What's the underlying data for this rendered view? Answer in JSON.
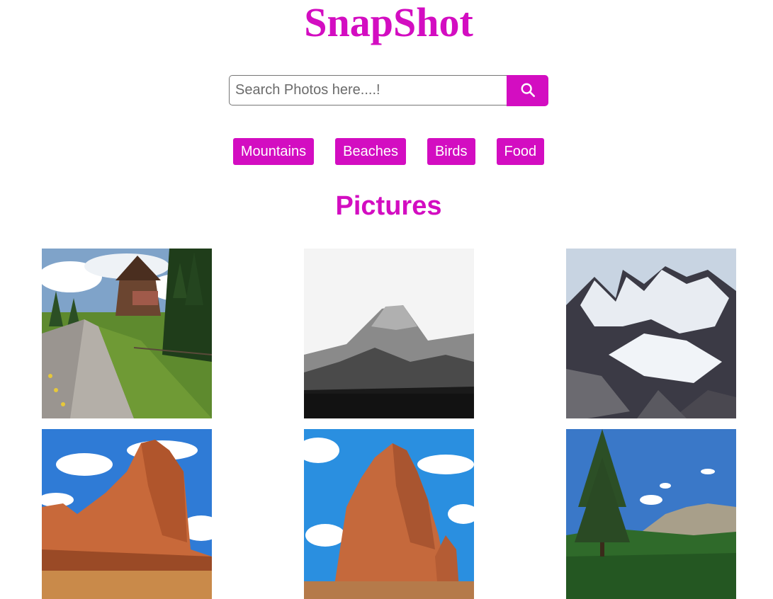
{
  "header": {
    "title": "SnapShot"
  },
  "search": {
    "placeholder": "Search Photos here....!",
    "value": ""
  },
  "categories": [
    {
      "label": "Mountains"
    },
    {
      "label": "Beaches"
    },
    {
      "label": "Birds"
    },
    {
      "label": "Food"
    }
  ],
  "gallery": {
    "title": "Pictures",
    "photos": [
      {
        "subject": "wooden-barn-trail"
      },
      {
        "subject": "misty-bw-mountain"
      },
      {
        "subject": "snowy-peaks"
      },
      {
        "subject": "red-rock-butte"
      },
      {
        "subject": "red-rock-tower"
      },
      {
        "subject": "alpine-forest-peak"
      }
    ]
  },
  "colors": {
    "accent": "#d30dc1",
    "background": "#ffffff"
  }
}
